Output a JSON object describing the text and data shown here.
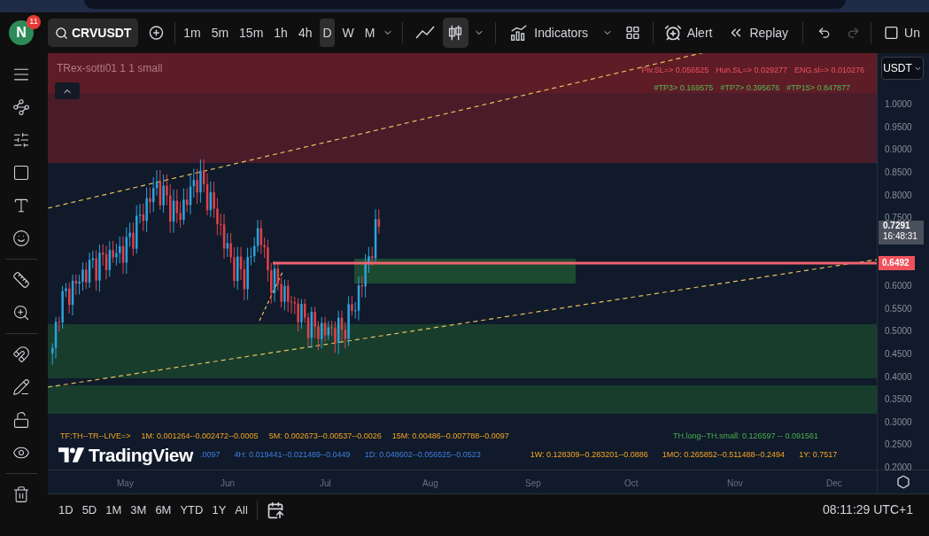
{
  "user": {
    "initial": "N",
    "notifications": "11"
  },
  "toolbar": {
    "symbol": "CRVUSDT",
    "intervals": [
      {
        "label": "1m",
        "selected": false
      },
      {
        "label": "5m",
        "selected": false
      },
      {
        "label": "15m",
        "selected": false
      },
      {
        "label": "1h",
        "selected": false
      },
      {
        "label": "4h",
        "selected": false
      },
      {
        "label": "D",
        "selected": true
      },
      {
        "label": "W",
        "selected": false
      },
      {
        "label": "M",
        "selected": false
      }
    ],
    "chart_styles": [
      {
        "kind": "line",
        "selected": false
      },
      {
        "kind": "candles",
        "selected": true
      }
    ],
    "indicators": "Indicators",
    "alert": "Alert",
    "replay": "Replay",
    "cut_label": "Un"
  },
  "chart": {
    "indicator_name": "TRex-sotti01 1 1 small",
    "stop_levels": [
      "Piv.SL=> 0.056525",
      "Hun.SL=> 0.029277",
      "ENG.sl=> 0.010276"
    ],
    "targets": [
      "#TP3> 0.169575",
      "#TP7> 0.395676",
      "#TP15> 0.847877"
    ],
    "live_row": [
      "TF:TH--TR--LIVE=>",
      "1M: 0.001264--0.002472--0.0005",
      "5M: 0.002673--0.00537--0.0026",
      "15M: 0.00486--0.007788--0.0097"
    ],
    "threshold": "TH.long--TH.small: 0.126597 -- 0.091561",
    "logo": "TradingView",
    "row_2": [
      {
        "text": ".0097",
        "kind": "blue"
      },
      {
        "text": "4H: 0.019441--0.021489--0.0449",
        "kind": "blue"
      },
      {
        "text": "1D: 0.048602--0.056525--0.0523",
        "kind": "blue"
      },
      {
        "text": "1W: 0.128309--0.283201--0.0886",
        "kind": "orange"
      },
      {
        "text": "1MO: 0.265852--0.511488--0.2494",
        "kind": "orange"
      },
      {
        "text": "1Y: 0.7517",
        "kind": "orange"
      }
    ]
  },
  "price_axis": {
    "currency": "USDT",
    "ticks": [
      "1.0000",
      "0.9500",
      "0.9000",
      "0.8500",
      "0.8000",
      "0.7500",
      "0.6000",
      "0.5500",
      "0.5000",
      "0.4500",
      "0.4000",
      "0.3500",
      "0.3000",
      "0.2500",
      "0.2000"
    ],
    "last_price": "0.7291",
    "countdown": "16:48:31",
    "level": "0.6492"
  },
  "time_axis": [
    "May",
    "Jun",
    "Jul",
    "Aug",
    "Sep",
    "Oct",
    "Nov",
    "Dec"
  ],
  "bottom_bar": {
    "ranges": [
      "1D",
      "5D",
      "1M",
      "3M",
      "6M",
      "YTD",
      "1Y",
      "All"
    ],
    "clock": "08:11:29 UTC+1"
  }
}
